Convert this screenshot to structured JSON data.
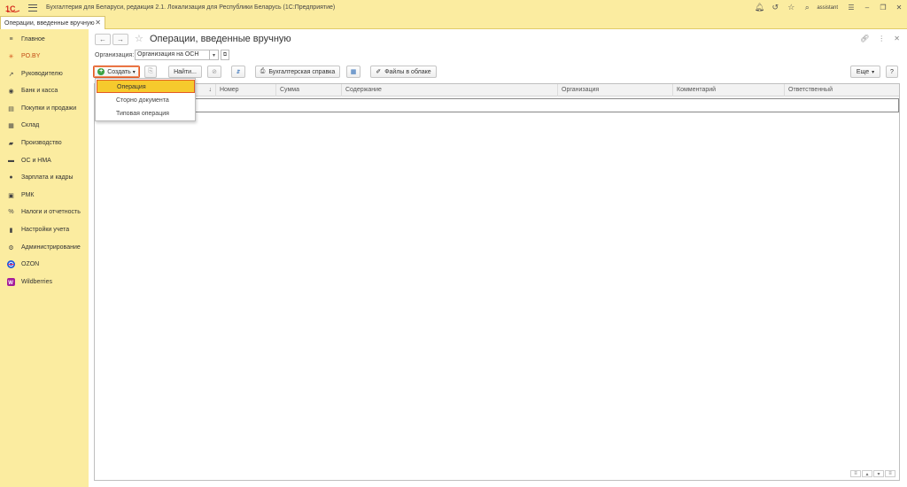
{
  "titlebar": {
    "app_title": "Бухгалтерия для Беларуси, редакция 2.1. Локализация для Республики Беларусь  (1С:Предприятие)",
    "user": "assistant"
  },
  "tab": {
    "label": "Операции, введенные вручную"
  },
  "sidebar": {
    "items": [
      {
        "label": "Главное",
        "icon": "menu-icon"
      },
      {
        "label": "PO.BY",
        "icon": "snowflake-icon"
      },
      {
        "label": "Руководителю",
        "icon": "trend-icon"
      },
      {
        "label": "Банк и касса",
        "icon": "bank-icon"
      },
      {
        "label": "Покупки и продажи",
        "icon": "cart-icon"
      },
      {
        "label": "Склад",
        "icon": "warehouse-icon"
      },
      {
        "label": "Производство",
        "icon": "factory-icon"
      },
      {
        "label": "ОС и НМА",
        "icon": "truck-icon"
      },
      {
        "label": "Зарплата и кадры",
        "icon": "person-icon"
      },
      {
        "label": "РМК",
        "icon": "register-icon"
      },
      {
        "label": "Налоги и отчетность",
        "icon": "percent-icon"
      },
      {
        "label": "Настройки учета",
        "icon": "book-icon"
      },
      {
        "label": "Администрирование",
        "icon": "gear-icon"
      },
      {
        "label": "OZON",
        "icon": "ozon-icon"
      },
      {
        "label": "Wildberries",
        "icon": "wildberries-icon"
      }
    ]
  },
  "main": {
    "title": "Операции, введенные вручную",
    "org_label": "Организация:",
    "org_value": "Организация на ОСН",
    "toolbar": {
      "create": "Создать",
      "find": "Найти...",
      "spravka": "Бухгалтерская справка",
      "files": "Файлы в облаке",
      "more": "Еще",
      "help": "?"
    },
    "columns": [
      "Номер",
      "Сумма",
      "Содержание",
      "Организация",
      "Комментарий",
      "Ответственный"
    ]
  },
  "dropdown": {
    "items": [
      "Операция",
      "Сторно документа",
      "Типовая операция"
    ]
  },
  "colors": {
    "accent": "#f6ca2d",
    "highlight_border": "#e25a27",
    "panel": "#fbeca0"
  }
}
